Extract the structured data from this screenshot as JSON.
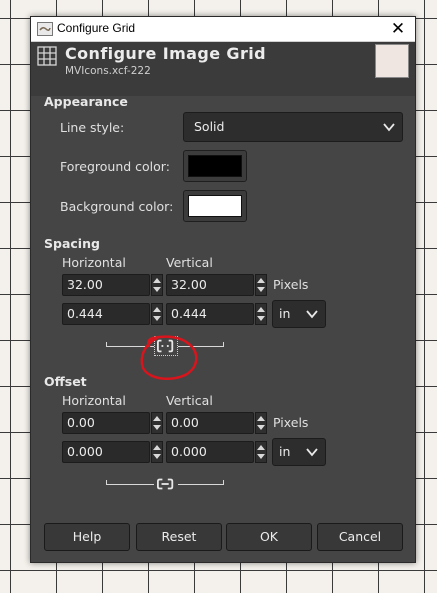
{
  "window": {
    "title": "Configure Grid",
    "close_icon": "close-icon"
  },
  "header": {
    "title": "Configure Image Grid",
    "subtitle": "MVIcons.xcf-222"
  },
  "appearance": {
    "heading": "Appearance",
    "line_style_label": "Line style:",
    "line_style_value": "Solid",
    "fg_label": "Foreground color:",
    "fg_color": "#000000",
    "bg_label": "Background color:",
    "bg_color": "#ffffff"
  },
  "spacing": {
    "heading": "Spacing",
    "horizontal_label": "Horizontal",
    "vertical_label": "Vertical",
    "h_pixels": "32.00",
    "v_pixels": "32.00",
    "pixels_unit": "Pixels",
    "h_inches": "0.444",
    "v_inches": "0.444",
    "unit_value": "in"
  },
  "offset": {
    "heading": "Offset",
    "horizontal_label": "Horizontal",
    "vertical_label": "Vertical",
    "h_pixels": "0.00",
    "v_pixels": "0.00",
    "pixels_unit": "Pixels",
    "h_inches": "0.000",
    "v_inches": "0.000",
    "unit_value": "in"
  },
  "footer": {
    "help": "Help",
    "reset": "Reset",
    "ok": "OK",
    "cancel": "Cancel"
  },
  "colors": {
    "dialog_bg": "#454545",
    "annotation": "#d8141c"
  }
}
